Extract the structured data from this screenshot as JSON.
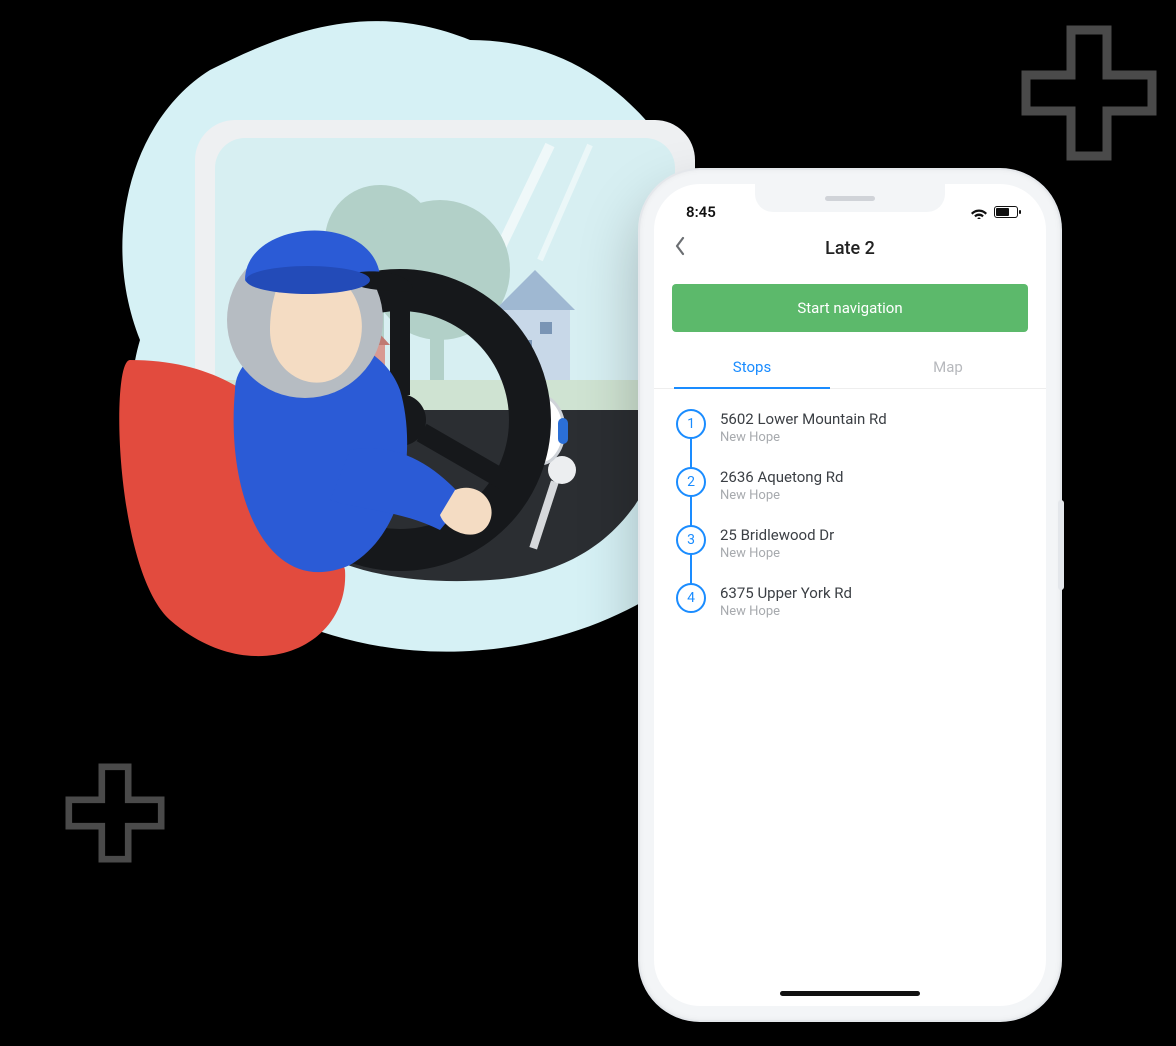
{
  "statusBar": {
    "time": "8:45"
  },
  "header": {
    "title": "Late 2"
  },
  "startButton": {
    "label": "Start navigation"
  },
  "tabs": {
    "stops": "Stops",
    "map": "Map"
  },
  "stops": [
    {
      "num": "1",
      "address": "5602 Lower Mountain Rd",
      "city": "New Hope"
    },
    {
      "num": "2",
      "address": "2636 Aquetong Rd",
      "city": "New Hope"
    },
    {
      "num": "3",
      "address": "25 Bridlewood Dr",
      "city": "New Hope"
    },
    {
      "num": "4",
      "address": "6375 Upper York Rd",
      "city": "New Hope"
    }
  ]
}
